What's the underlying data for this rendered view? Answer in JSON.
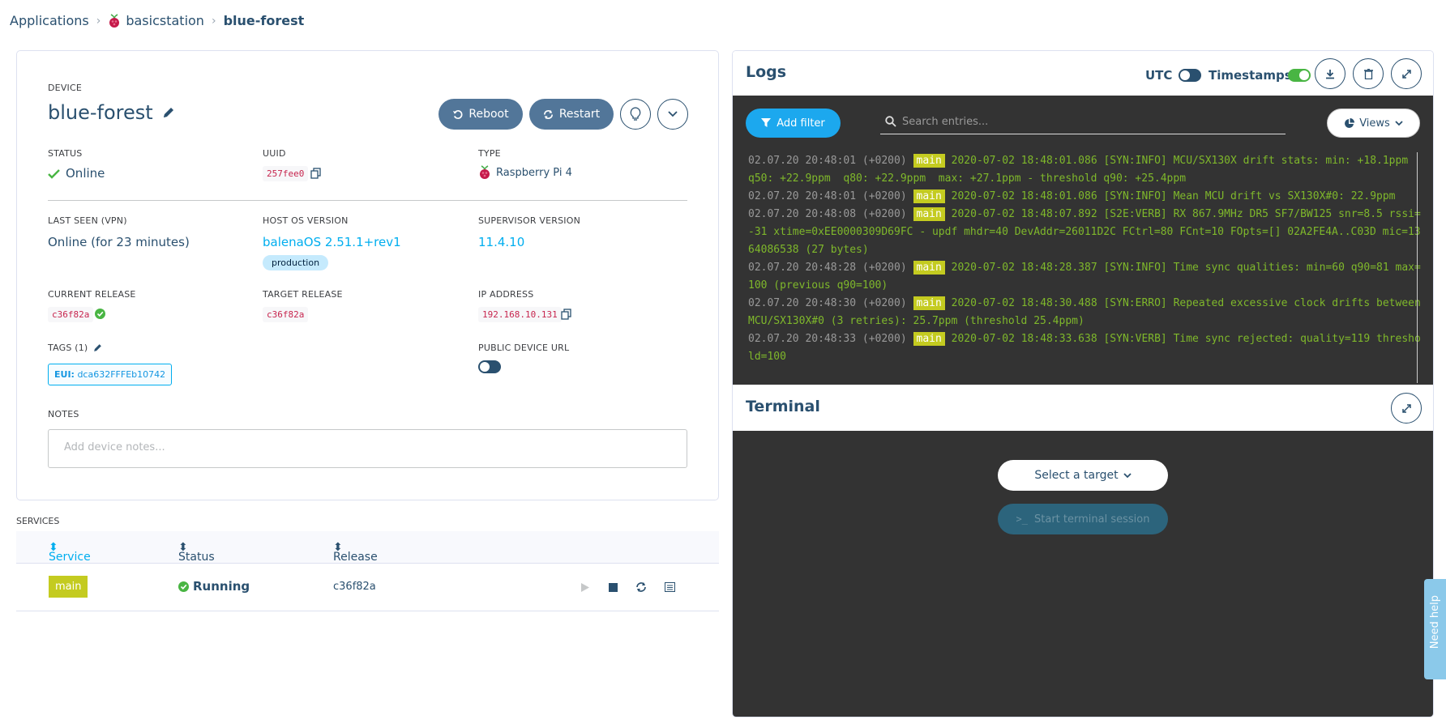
{
  "breadcrumb": {
    "root": "Applications",
    "app": "basicstation",
    "device": "blue-forest"
  },
  "device": {
    "section_label": "DEVICE",
    "name": "blue-forest",
    "reboot_label": "Reboot",
    "restart_label": "Restart",
    "status_label": "STATUS",
    "status_value": "Online",
    "uuid_label": "UUID",
    "uuid_value": "257fee0",
    "type_label": "TYPE",
    "type_value": "Raspberry Pi 4",
    "last_seen_label": "LAST SEEN (VPN)",
    "last_seen_value": "Online (for 23 minutes)",
    "host_os_label": "HOST OS VERSION",
    "host_os_value": "balenaOS 2.51.1+rev1",
    "host_os_badge": "production",
    "supervisor_label": "SUPERVISOR VERSION",
    "supervisor_value": "11.4.10",
    "current_release_label": "CURRENT RELEASE",
    "current_release_value": "c36f82a",
    "target_release_label": "TARGET RELEASE",
    "target_release_value": "c36f82a",
    "ip_label": "IP ADDRESS",
    "ip_value": "192.168.10.131",
    "tags_label": "TAGS (1)",
    "tag_key": "EUI:",
    "tag_value": "dca632FFFEb10742",
    "public_url_label": "PUBLIC DEVICE URL",
    "notes_label": "NOTES",
    "notes_placeholder": "Add device notes..."
  },
  "services": {
    "title": "SERVICES",
    "columns": [
      "Service",
      "Status",
      "Release"
    ],
    "rows": [
      {
        "service": "main",
        "status": "Running",
        "release": "c36f82a"
      }
    ]
  },
  "logs": {
    "title": "Logs",
    "utc_label": "UTC",
    "timestamps_label": "Timestamps",
    "add_filter_label": "Add filter",
    "search_placeholder": "Search entries...",
    "views_label": "Views",
    "lines": [
      {
        "ts": "02.07.20 20:48:01 (+0200)",
        "svc": "main",
        "msg": "2020-07-02 18:48:01.086 [SYN:INFO] MCU/SX130X drift stats: min: +18.1ppm  q50: +22.9ppm  q80: +22.9ppm  max: +27.1ppm - threshold q90: +25.4ppm"
      },
      {
        "ts": "02.07.20 20:48:01 (+0200)",
        "svc": "main",
        "msg": "2020-07-02 18:48:01.086 [SYN:INFO] Mean MCU drift vs SX130X#0: 22.9ppm"
      },
      {
        "ts": "02.07.20 20:48:08 (+0200)",
        "svc": "main",
        "msg": "2020-07-02 18:48:07.892 [S2E:VERB] RX 867.9MHz DR5 SF7/BW125 snr=8.5 rssi=-31 xtime=0xEE0000309D69FC - updf mhdr=40 DevAddr=26011D2C FCtrl=80 FCnt=10 FOpts=[] 02A2FE4A..C03D mic=1364086538 (27 bytes)"
      },
      {
        "ts": "02.07.20 20:48:28 (+0200)",
        "svc": "main",
        "msg": "2020-07-02 18:48:28.387 [SYN:INFO] Time sync qualities: min=60 q90=81 max=100 (previous q90=100)"
      },
      {
        "ts": "02.07.20 20:48:30 (+0200)",
        "svc": "main",
        "msg": "2020-07-02 18:48:30.488 [SYN:ERRO] Repeated excessive clock drifts between MCU/SX130X#0 (3 retries): 25.7ppm (threshold 25.4ppm)"
      },
      {
        "ts": "02.07.20 20:48:33 (+0200)",
        "svc": "main",
        "msg": "2020-07-02 18:48:33.638 [SYN:VERB] Time sync rejected: quality=119 threshold=100"
      }
    ]
  },
  "terminal": {
    "title": "Terminal",
    "select_target_label": "Select a target",
    "start_session_label": "Start terminal session"
  },
  "help": {
    "label": "Need help"
  },
  "colors": {
    "accent": "#1ca8ee",
    "brand": "#2a506f",
    "success": "#49b543",
    "service_chip": "#c4cb20"
  }
}
